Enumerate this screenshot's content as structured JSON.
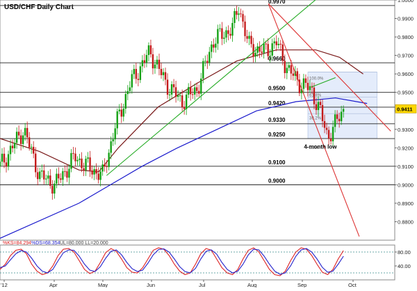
{
  "chart_data": [
    {
      "type": "candlestick",
      "title": "USD/CHF Daily Chart",
      "x": {
        "tick_labels": [
          "'12",
          "Apr",
          "May",
          "Jun",
          "Jul",
          "Aug",
          "Sep",
          "Oct"
        ]
      },
      "y": {
        "range": [
          0.87,
          1.0
        ],
        "tick_labels": [
          "1.0000",
          "0.9900",
          "0.9800",
          "0.9700",
          "0.9600",
          "0.9500",
          "0.9400",
          "0.9300",
          "0.9200",
          "0.9100",
          "0.9000",
          "0.8900",
          "0.8800"
        ],
        "tick_values": [
          1.0,
          0.99,
          0.98,
          0.97,
          0.96,
          0.95,
          0.94,
          0.93,
          0.92,
          0.91,
          0.9,
          0.89,
          0.88
        ]
      },
      "current_price_label": "0.9411",
      "current_price": 0.9411,
      "horizontal_levels": [
        {
          "value": 0.997,
          "label": "0.9970"
        },
        {
          "value": 0.966,
          "label": "0.9660"
        },
        {
          "value": 0.95,
          "label": "0.9500"
        },
        {
          "value": 0.942,
          "label": "0.9420"
        },
        {
          "value": 0.933,
          "label": "0.9330"
        },
        {
          "value": 0.925,
          "label": "0.9250"
        },
        {
          "value": 0.91,
          "label": "0.9100"
        },
        {
          "value": 0.9,
          "label": "0.9000"
        }
      ],
      "fibonacci_labels": [
        "100.0%",
        "61.8%",
        "38.2%",
        "0.0%"
      ],
      "annotations": [
        "4-month low"
      ],
      "moving_averages": [
        {
          "color": "#1a1acc",
          "points": [
            [
              0.0,
              0.871
            ],
            [
              0.2,
              0.89
            ],
            [
              0.28,
              0.9
            ],
            [
              0.36,
              0.91
            ],
            [
              0.45,
              0.92
            ],
            [
              0.55,
              0.93
            ],
            [
              0.65,
              0.94
            ],
            [
              0.75,
              0.945
            ],
            [
              0.85,
              0.947
            ],
            [
              0.93,
              0.944
            ]
          ]
        },
        {
          "color": "#7a1a1a",
          "points": [
            [
              0.0,
              0.925
            ],
            [
              0.1,
              0.918
            ],
            [
              0.2,
              0.908
            ],
            [
              0.25,
              0.907
            ],
            [
              0.3,
              0.92
            ],
            [
              0.4,
              0.942
            ],
            [
              0.5,
              0.955
            ],
            [
              0.6,
              0.967
            ],
            [
              0.7,
              0.973
            ],
            [
              0.8,
              0.973
            ],
            [
              0.86,
              0.969
            ],
            [
              0.92,
              0.96
            ]
          ]
        }
      ],
      "trendlines": [
        {
          "color": "#22aa22",
          "points": [
            [
              0.27,
              0.905
            ],
            [
              0.81,
              1.002
            ]
          ]
        },
        {
          "color": "#22aa22",
          "points": [
            [
              0.79,
              0.953
            ],
            [
              0.85,
              0.958
            ]
          ]
        },
        {
          "color": "#dd3333",
          "points": [
            [
              0.68,
              0.998
            ],
            [
              0.99,
              0.929
            ]
          ]
        },
        {
          "color": "#dd3333",
          "points": [
            [
              0.68,
              0.998
            ],
            [
              0.91,
              0.872
            ]
          ]
        }
      ],
      "fib_box": {
        "x_from": 0.78,
        "x_to": 0.955,
        "high": 0.961,
        "low": 0.925
      }
    },
    {
      "type": "line",
      "title": "Stochastic oscillator",
      "legend": [
        {
          "label": "%KS=84.294",
          "color": "#dd2222"
        },
        {
          "label": "%DS=68.354",
          "color": "#2222cc"
        },
        {
          "label": "UL=80.000 LL=20.000",
          "color": "#444444"
        }
      ],
      "y": {
        "tick_labels": [
          "80.00",
          "40.00"
        ],
        "tick_values": [
          80,
          40
        ]
      },
      "levels": [
        80,
        20
      ],
      "series": [
        {
          "color": "#dd2222",
          "values": [
            30,
            45,
            70,
            85,
            88,
            75,
            45,
            25,
            15,
            20,
            40,
            70,
            88,
            90,
            80,
            55,
            30,
            18,
            25,
            50,
            78,
            90,
            82,
            60,
            35,
            22,
            20,
            35,
            60,
            85,
            92,
            88,
            70,
            45,
            25,
            15,
            20,
            45,
            75,
            90,
            85,
            60,
            35,
            20,
            15,
            30,
            60,
            85,
            92,
            80,
            55,
            30,
            15,
            12,
            25,
            55,
            80,
            92,
            88,
            70,
            45,
            22,
            15,
            30,
            60,
            84
          ]
        },
        {
          "color": "#2222cc",
          "values": [
            35,
            40,
            58,
            75,
            84,
            80,
            62,
            40,
            25,
            20,
            30,
            55,
            78,
            86,
            85,
            68,
            45,
            28,
            24,
            38,
            62,
            82,
            86,
            72,
            50,
            32,
            24,
            28,
            48,
            72,
            87,
            89,
            80,
            60,
            38,
            24,
            20,
            33,
            60,
            82,
            86,
            74,
            50,
            30,
            20,
            25,
            45,
            72,
            88,
            86,
            68,
            45,
            25,
            16,
            20,
            40,
            68,
            86,
            90,
            80,
            60,
            36,
            22,
            25,
            45,
            68
          ]
        }
      ]
    }
  ]
}
